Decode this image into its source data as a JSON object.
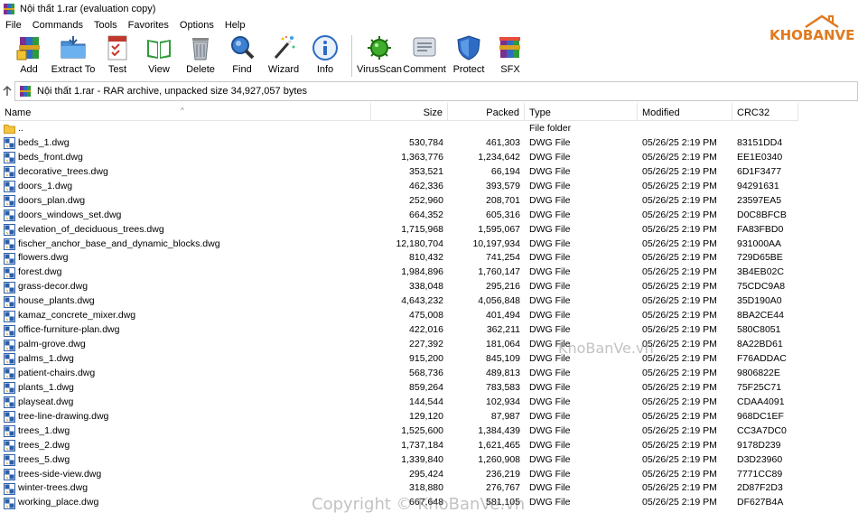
{
  "window": {
    "title": "Nội thất 1.rar (evaluation copy)"
  },
  "menu": [
    "File",
    "Commands",
    "Tools",
    "Favorites",
    "Options",
    "Help"
  ],
  "logo": {
    "text": "KHOBANVE"
  },
  "toolbar": {
    "group1": [
      {
        "label": "Add",
        "icon": "add-archive-icon"
      },
      {
        "label": "Extract To",
        "icon": "extract-to-icon"
      },
      {
        "label": "Test",
        "icon": "test-icon"
      },
      {
        "label": "View",
        "icon": "view-icon"
      },
      {
        "label": "Delete",
        "icon": "delete-icon"
      },
      {
        "label": "Find",
        "icon": "find-icon"
      },
      {
        "label": "Wizard",
        "icon": "wizard-icon"
      },
      {
        "label": "Info",
        "icon": "info-icon"
      }
    ],
    "group2": [
      {
        "label": "VirusScan",
        "icon": "virusscan-icon"
      },
      {
        "label": "Comment",
        "icon": "comment-icon"
      },
      {
        "label": "Protect",
        "icon": "protect-icon"
      },
      {
        "label": "SFX",
        "icon": "sfx-icon"
      }
    ]
  },
  "address": {
    "text": "Nội thất 1.rar - RAR archive, unpacked size 34,927,057 bytes"
  },
  "columns": {
    "name": "Name",
    "size": "Size",
    "packed": "Packed",
    "type": "Type",
    "modified": "Modified",
    "crc": "CRC32"
  },
  "files": [
    {
      "name": "..",
      "size": "",
      "packed": "",
      "type": "File folder",
      "modified": "",
      "crc": "",
      "folder": true
    },
    {
      "name": "beds_1.dwg",
      "size": "530,784",
      "packed": "461,303",
      "type": "DWG File",
      "modified": "05/26/25 2:19 PM",
      "crc": "83151DD4"
    },
    {
      "name": "beds_front.dwg",
      "size": "1,363,776",
      "packed": "1,234,642",
      "type": "DWG File",
      "modified": "05/26/25 2:19 PM",
      "crc": "EE1E0340"
    },
    {
      "name": "decorative_trees.dwg",
      "size": "353,521",
      "packed": "66,194",
      "type": "DWG File",
      "modified": "05/26/25 2:19 PM",
      "crc": "6D1F3477"
    },
    {
      "name": "doors_1.dwg",
      "size": "462,336",
      "packed": "393,579",
      "type": "DWG File",
      "modified": "05/26/25 2:19 PM",
      "crc": "94291631"
    },
    {
      "name": "doors_plan.dwg",
      "size": "252,960",
      "packed": "208,701",
      "type": "DWG File",
      "modified": "05/26/25 2:19 PM",
      "crc": "23597EA5"
    },
    {
      "name": "doors_windows_set.dwg",
      "size": "664,352",
      "packed": "605,316",
      "type": "DWG File",
      "modified": "05/26/25 2:19 PM",
      "crc": "D0C8BFCB"
    },
    {
      "name": "elevation_of_deciduous_trees.dwg",
      "size": "1,715,968",
      "packed": "1,595,067",
      "type": "DWG File",
      "modified": "05/26/25 2:19 PM",
      "crc": "FA83FBD0"
    },
    {
      "name": "fischer_anchor_base_and_dynamic_blocks.dwg",
      "size": "12,180,704",
      "packed": "10,197,934",
      "type": "DWG File",
      "modified": "05/26/25 2:19 PM",
      "crc": "931000AA"
    },
    {
      "name": "flowers.dwg",
      "size": "810,432",
      "packed": "741,254",
      "type": "DWG File",
      "modified": "05/26/25 2:19 PM",
      "crc": "729D65BE"
    },
    {
      "name": "forest.dwg",
      "size": "1,984,896",
      "packed": "1,760,147",
      "type": "DWG File",
      "modified": "05/26/25 2:19 PM",
      "crc": "3B4EB02C"
    },
    {
      "name": "grass-decor.dwg",
      "size": "338,048",
      "packed": "295,216",
      "type": "DWG File",
      "modified": "05/26/25 2:19 PM",
      "crc": "75CDC9A8"
    },
    {
      "name": "house_plants.dwg",
      "size": "4,643,232",
      "packed": "4,056,848",
      "type": "DWG File",
      "modified": "05/26/25 2:19 PM",
      "crc": "35D190A0"
    },
    {
      "name": "kamaz_concrete_mixer.dwg",
      "size": "475,008",
      "packed": "401,494",
      "type": "DWG File",
      "modified": "05/26/25 2:19 PM",
      "crc": "8BA2CE44"
    },
    {
      "name": "office-furniture-plan.dwg",
      "size": "422,016",
      "packed": "362,211",
      "type": "DWG File",
      "modified": "05/26/25 2:19 PM",
      "crc": "580C8051"
    },
    {
      "name": "palm-grove.dwg",
      "size": "227,392",
      "packed": "181,064",
      "type": "DWG File",
      "modified": "05/26/25 2:19 PM",
      "crc": "8A22BD61"
    },
    {
      "name": "palms_1.dwg",
      "size": "915,200",
      "packed": "845,109",
      "type": "DWG File",
      "modified": "05/26/25 2:19 PM",
      "crc": "F76ADDAC"
    },
    {
      "name": "patient-chairs.dwg",
      "size": "568,736",
      "packed": "489,813",
      "type": "DWG File",
      "modified": "05/26/25 2:19 PM",
      "crc": "9806822E"
    },
    {
      "name": "plants_1.dwg",
      "size": "859,264",
      "packed": "783,583",
      "type": "DWG File",
      "modified": "05/26/25 2:19 PM",
      "crc": "75F25C71"
    },
    {
      "name": "playseat.dwg",
      "size": "144,544",
      "packed": "102,934",
      "type": "DWG File",
      "modified": "05/26/25 2:19 PM",
      "crc": "CDAA4091"
    },
    {
      "name": "tree-line-drawing.dwg",
      "size": "129,120",
      "packed": "87,987",
      "type": "DWG File",
      "modified": "05/26/25 2:19 PM",
      "crc": "968DC1EF"
    },
    {
      "name": "trees_1.dwg",
      "size": "1,525,600",
      "packed": "1,384,439",
      "type": "DWG File",
      "modified": "05/26/25 2:19 PM",
      "crc": "CC3A7DC0"
    },
    {
      "name": "trees_2.dwg",
      "size": "1,737,184",
      "packed": "1,621,465",
      "type": "DWG File",
      "modified": "05/26/25 2:19 PM",
      "crc": "9178D239"
    },
    {
      "name": "trees_5.dwg",
      "size": "1,339,840",
      "packed": "1,260,908",
      "type": "DWG File",
      "modified": "05/26/25 2:19 PM",
      "crc": "D3D23960"
    },
    {
      "name": "trees-side-view.dwg",
      "size": "295,424",
      "packed": "236,219",
      "type": "DWG File",
      "modified": "05/26/25 2:19 PM",
      "crc": "7771CC89"
    },
    {
      "name": "winter-trees.dwg",
      "size": "318,880",
      "packed": "276,767",
      "type": "DWG File",
      "modified": "05/26/25 2:19 PM",
      "crc": "2D87F2D3"
    },
    {
      "name": "working_place.dwg",
      "size": "667,648",
      "packed": "581,105",
      "type": "DWG File",
      "modified": "05/26/25 2:19 PM",
      "crc": "DF627B4A"
    }
  ],
  "watermarks": [
    "KhoBanVe.vn",
    "Copyright © KhoBanVe.vn"
  ]
}
